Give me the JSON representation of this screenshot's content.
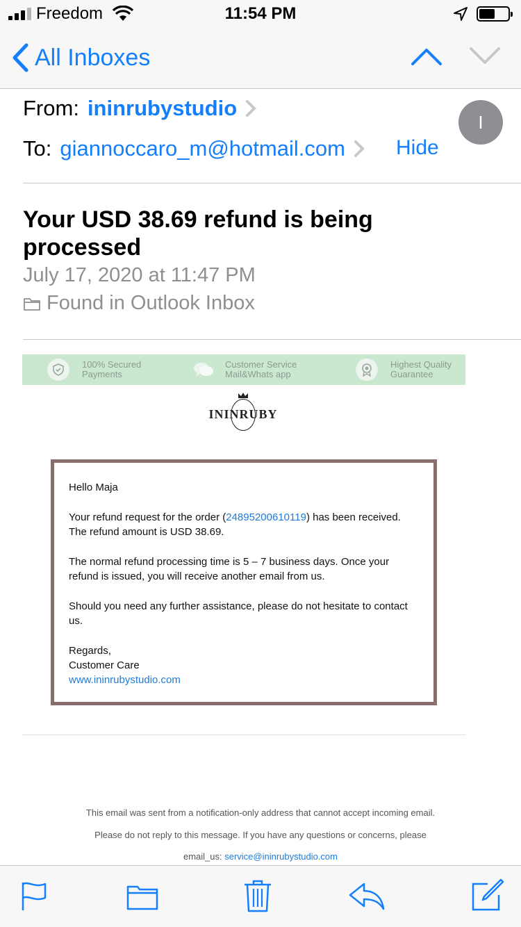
{
  "status": {
    "carrier": "Freedom",
    "time": "11:54 PM"
  },
  "nav": {
    "back_label": "All Inboxes"
  },
  "header": {
    "from_label": "From:",
    "from_name": "ininrubystudio",
    "to_label": "To:",
    "to_address": "giannoccaro_m@hotmail.com",
    "hide_label": "Hide",
    "avatar_initial": "I"
  },
  "message": {
    "subject": "Your USD 38.69  refund is being processed",
    "date": "July 17, 2020 at 11:47 PM",
    "folder": "Found in Outlook Inbox"
  },
  "features": [
    {
      "line1": "100% Secured",
      "line2": "Payments",
      "icon": "shield-icon"
    },
    {
      "line1": "Customer Service",
      "line2": "Mail&Whats app",
      "icon": "chat-icon"
    },
    {
      "line1": "Highest Quality",
      "line2": "Guarantee",
      "icon": "badge-icon"
    }
  ],
  "brand": {
    "logo_text": "ININRUBY"
  },
  "body": {
    "greeting": "Hello Maja",
    "p1_before": "Your refund request for the order (",
    "order_number": "24895200610119",
    "p1_after": ") has been received. The refund amount is USD 38.69.",
    "p2": "The normal refund processing time is 5 – 7 business days. Once your refund is issued, you will receive another email from us.",
    "p3": "Should you need any further assistance, please do not hesitate to contact us.",
    "regards": "Regards,",
    "signature": "Customer Care",
    "website": "www.ininrubystudio.com"
  },
  "footer": {
    "line1": "This email was sent from a notification-only address that cannot accept incoming email.",
    "line2": "Please do not reply to this message. If you have any questions or concerns, please",
    "line3_prefix": "email_us: ",
    "line3_email": "service@ininrubystudio.com"
  },
  "colors": {
    "accent": "#147efb",
    "feature_bar": "#c9e8cf",
    "box_border": "#8a6d6d"
  },
  "toolbar_icons": [
    "flag-icon",
    "folder-icon",
    "trash-icon",
    "reply-icon",
    "compose-icon"
  ]
}
